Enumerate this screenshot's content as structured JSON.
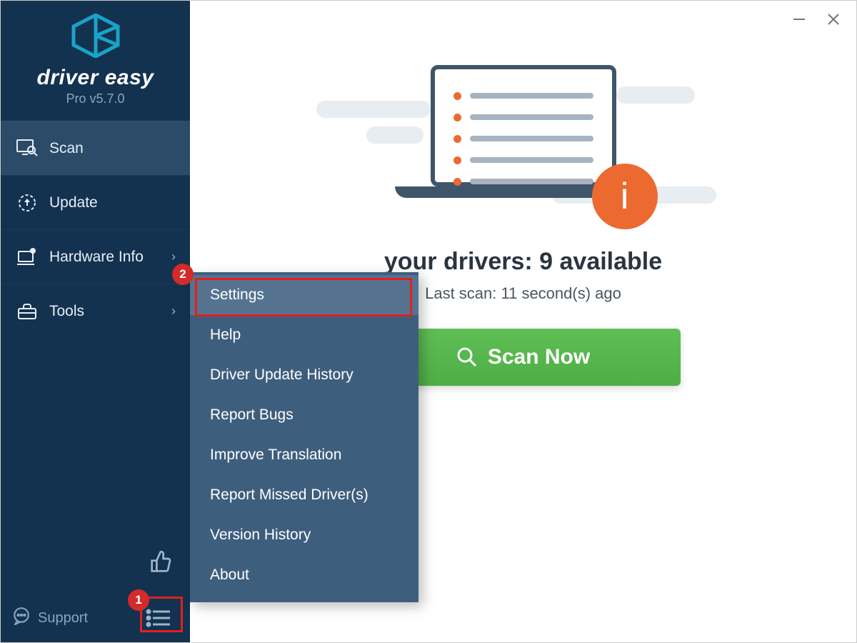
{
  "brand": {
    "name": "driver easy",
    "version": "Pro v5.7.0"
  },
  "nav": {
    "scan": "Scan",
    "update": "Update",
    "hardware": "Hardware Info",
    "tools": "Tools"
  },
  "support_label": "Support",
  "popup": {
    "settings": "Settings",
    "help": "Help",
    "history": "Driver Update History",
    "bugs": "Report Bugs",
    "translate": "Improve Translation",
    "missed": "Report Missed Driver(s)",
    "version": "Version History",
    "about": "About"
  },
  "main": {
    "headline": "your drivers: 9 available",
    "subline": "Last scan: 11 second(s) ago",
    "scan_button": "Scan Now",
    "info_badge": "i"
  },
  "markers": {
    "one": "1",
    "two": "2"
  }
}
